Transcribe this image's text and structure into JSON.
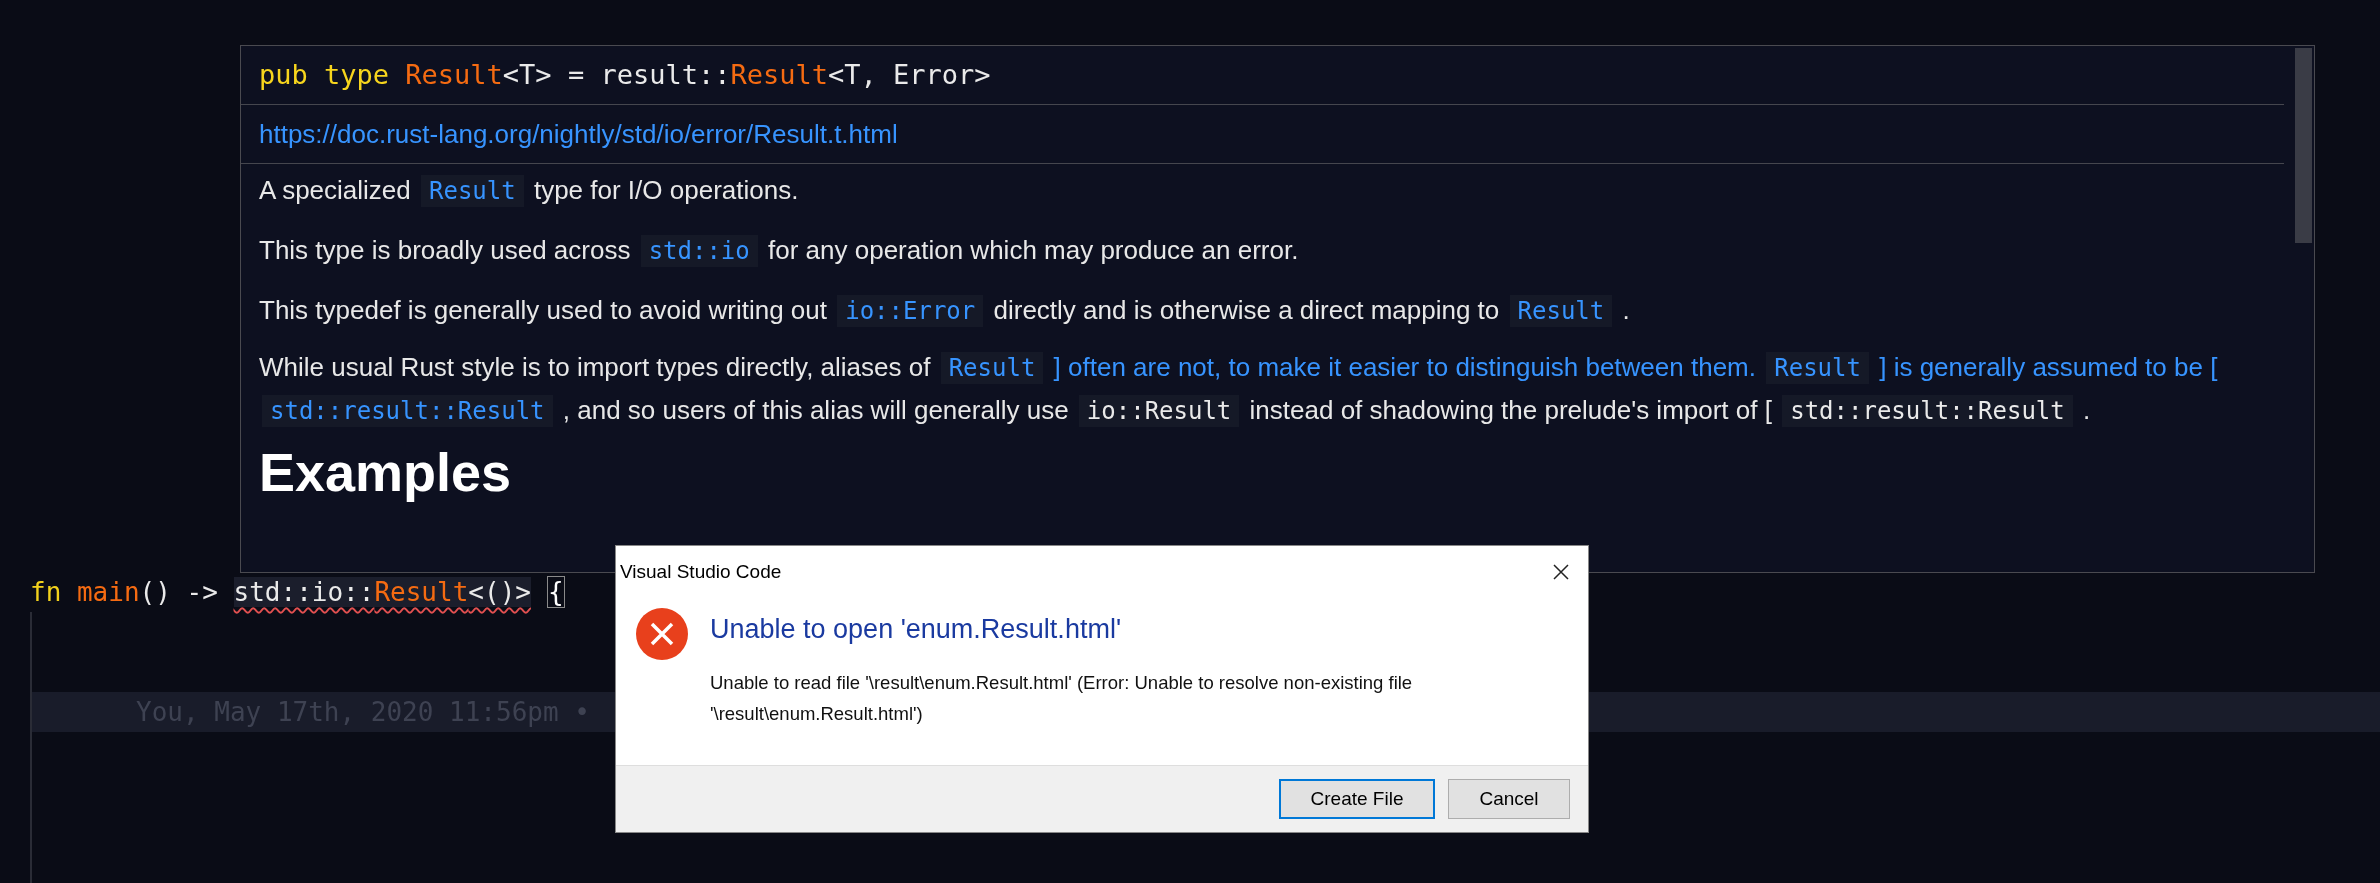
{
  "hover": {
    "signature": [
      {
        "kind": "keyword",
        "text": "pub type "
      },
      {
        "kind": "type",
        "text": "Result"
      },
      {
        "kind": "plain",
        "text": "<T> = result::"
      },
      {
        "kind": "type",
        "text": "Result"
      },
      {
        "kind": "plain",
        "text": "<T, Error>"
      }
    ],
    "url": "https://doc.rust-lang.org/nightly/std/io/error/Result.t.html",
    "paragraphs": [
      [
        {
          "kind": "text",
          "text": "A specialized"
        },
        {
          "kind": "code-link",
          "text": "Result"
        },
        {
          "kind": "text",
          "text": "type for I/O operations."
        }
      ],
      [
        {
          "kind": "text",
          "text": "This type is broadly used across"
        },
        {
          "kind": "code-link",
          "text": "std::io"
        },
        {
          "kind": "text",
          "text": "for any operation which may produce an error."
        }
      ],
      [
        {
          "kind": "text",
          "text": "This typedef is generally used to avoid writing out"
        },
        {
          "kind": "code-link",
          "text": "io::Error"
        },
        {
          "kind": "text",
          "text": "directly and is otherwise a direct mapping to"
        },
        {
          "kind": "code-link",
          "text": "Result"
        },
        {
          "kind": "text",
          "text": "."
        }
      ],
      [
        {
          "kind": "text",
          "text": "While usual Rust style is to import types directly, aliases of"
        },
        {
          "kind": "code-link",
          "text": "Result"
        },
        {
          "kind": "link",
          "text": "] often are not, to make it easier to distinguish between them."
        },
        {
          "kind": "code-link",
          "text": "Result"
        },
        {
          "kind": "link",
          "text": "] is generally"
        },
        {
          "kind": "link",
          "text": "assumed to be ["
        },
        {
          "kind": "code-link",
          "text": "std::result::Result"
        },
        {
          "kind": "text",
          "text": ", and so users of this alias will generally use"
        },
        {
          "kind": "code",
          "text": "io::Result"
        },
        {
          "kind": "text",
          "text": "instead of shadowing the prelude's import of"
        },
        {
          "kind": "text",
          "text": "["
        },
        {
          "kind": "code",
          "text": "std::result::Result"
        },
        {
          "kind": "text",
          "text": "."
        }
      ]
    ],
    "heading": "Examples"
  },
  "editor": {
    "line": [
      {
        "kind": "keyword",
        "text": "fn "
      },
      {
        "kind": "function",
        "text": "main"
      },
      {
        "kind": "plain",
        "text": "() -> "
      }
    ],
    "error_tokens": [
      {
        "kind": "plain",
        "text": "std::io::"
      },
      {
        "kind": "type",
        "text": "Result"
      },
      {
        "kind": "plain",
        "text": "<()>"
      }
    ],
    "bracket": "{",
    "blame": "You, May 17th, 2020 11:56pm •"
  },
  "dialog": {
    "title": "Visual Studio Code",
    "heading": "Unable to open 'enum.Result.html'",
    "message": "Unable to read file '\\result\\enum.Result.html' (Error: Unable to resolve non-existing file '\\result\\enum.Result.html')",
    "buttons": [
      {
        "label": "Create File",
        "default": true
      },
      {
        "label": "Cancel",
        "default": false
      }
    ]
  }
}
